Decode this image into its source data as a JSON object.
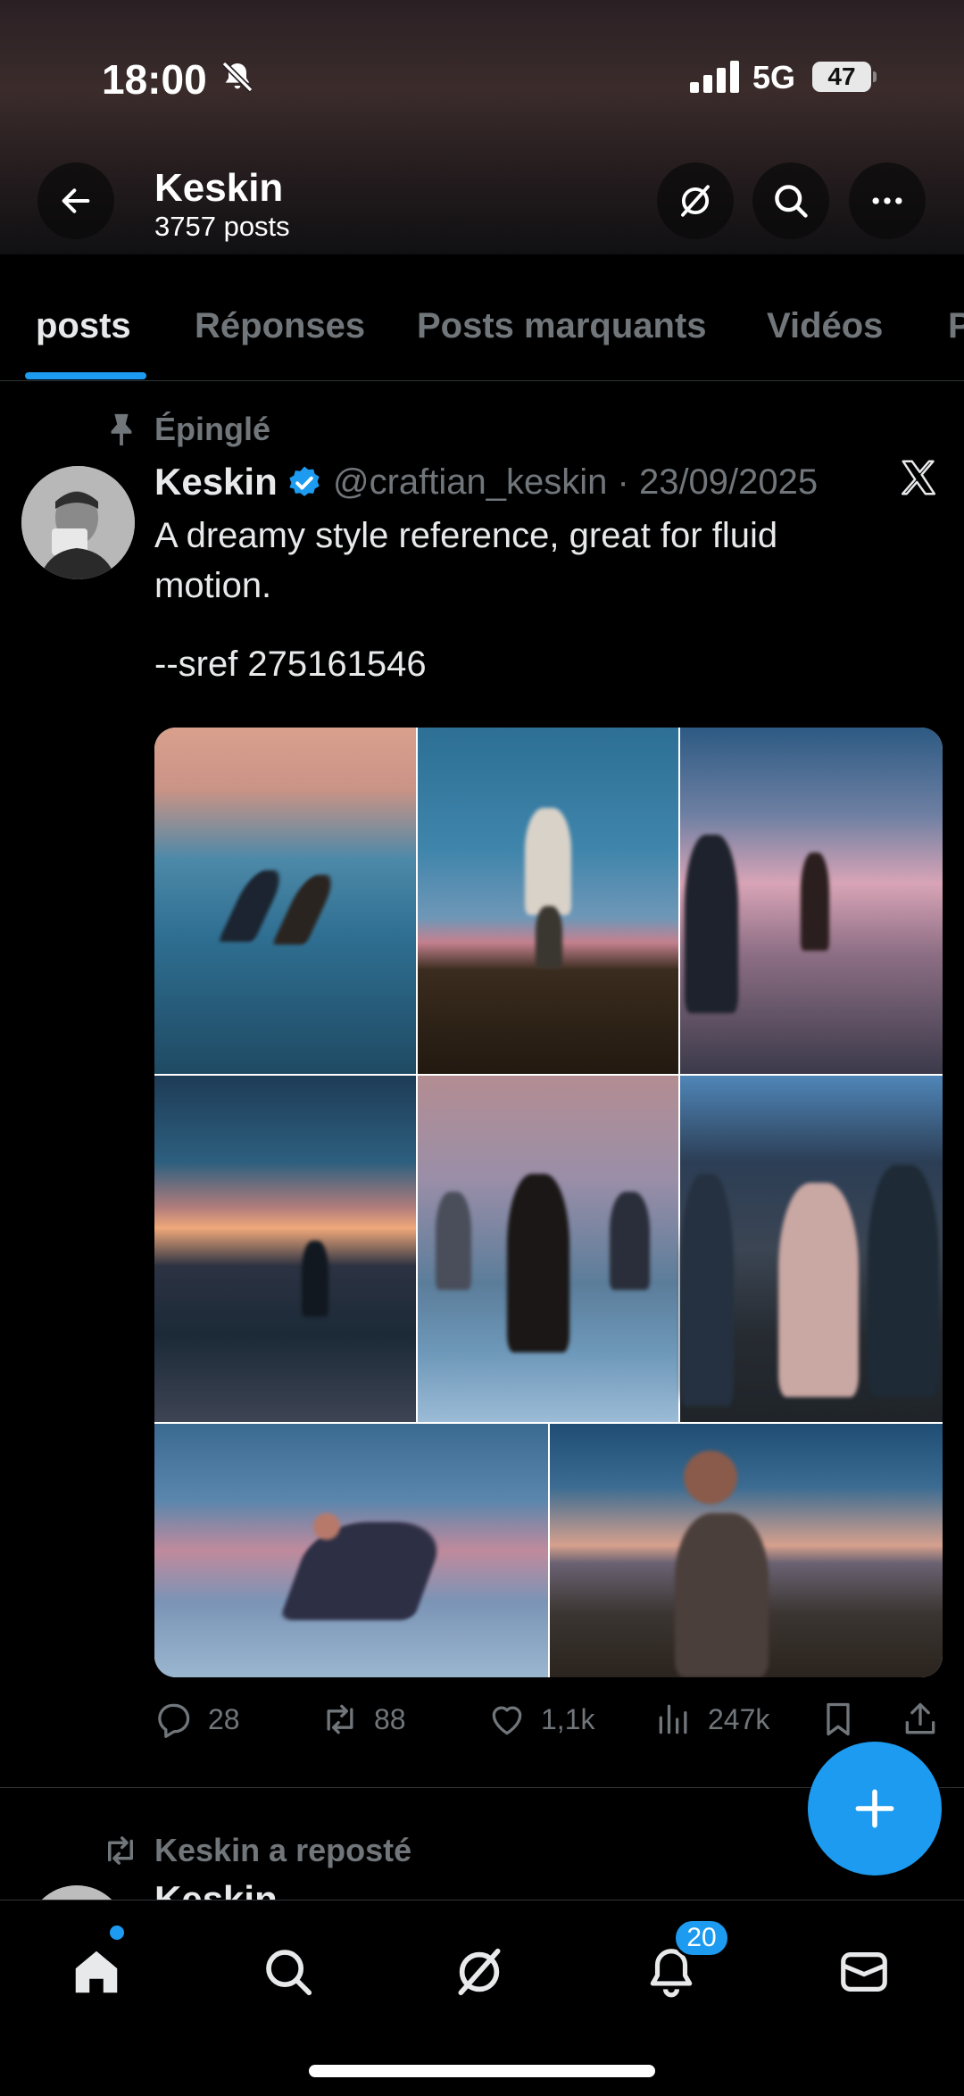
{
  "status_bar": {
    "time": "18:00",
    "network": "5G",
    "battery": "47"
  },
  "header": {
    "name": "Keskin",
    "post_count": "3757 posts"
  },
  "tabs": [
    {
      "label": "posts",
      "active": true
    },
    {
      "label": "Réponses"
    },
    {
      "label": "Posts marquants"
    },
    {
      "label": "Vidéos"
    },
    {
      "label": "P"
    }
  ],
  "pinned_tweet": {
    "pinned_label": "Épinglé",
    "author": "Keskin",
    "handle_date": "@craftian_keskin · 23/09/2025",
    "text_lines": [
      "A dreamy style reference, great for fluid",
      "motion.",
      "--sref 275161546"
    ],
    "stats": {
      "replies": "28",
      "reposts": "88",
      "likes": "1,1k",
      "views": "247k"
    }
  },
  "next_item": {
    "repost_label": "Keskin a reposté",
    "author": "Keskin"
  },
  "bottom_nav": {
    "notifications_badge": "20"
  },
  "colors": {
    "accent": "#1d9bf0",
    "muted": "#71767b",
    "text": "#e7e9ea",
    "background": "#000000"
  },
  "icons": [
    "back-arrow-icon",
    "grok-icon",
    "search-icon",
    "more-icon",
    "pin-icon",
    "verified-icon",
    "x-logo-icon",
    "reply-icon",
    "repost-icon",
    "like-icon",
    "views-icon",
    "bookmark-icon",
    "share-icon",
    "plus-icon",
    "home-icon",
    "bell-icon",
    "mail-icon"
  ]
}
